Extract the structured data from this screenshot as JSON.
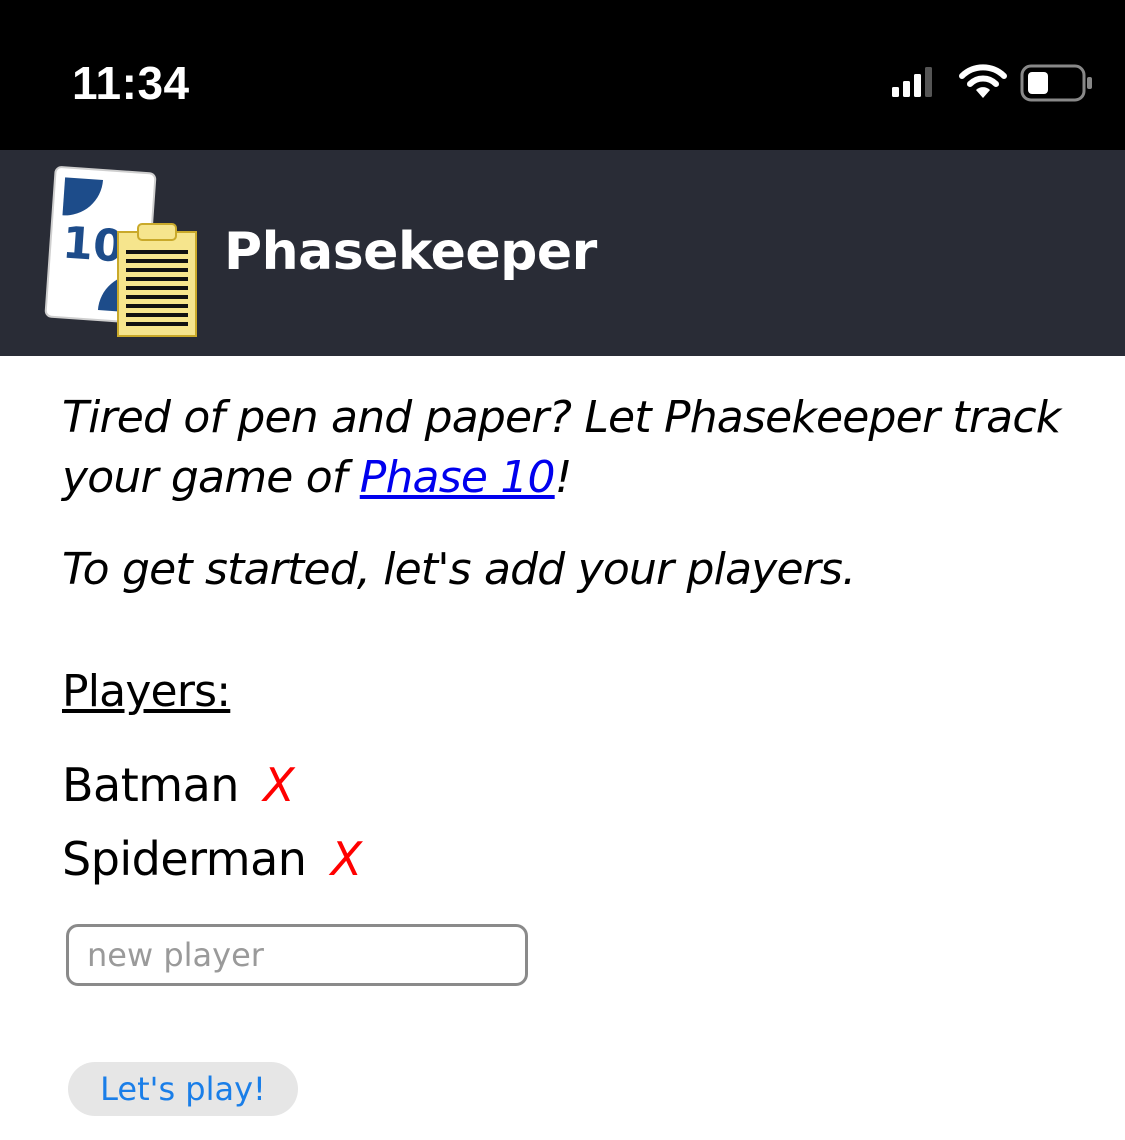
{
  "status_bar": {
    "time": "11:34",
    "icons": [
      "signal-icon",
      "wifi-icon",
      "battery-icon"
    ]
  },
  "header": {
    "title": "Phasekeeper",
    "logo_card_text": "10",
    "background": "#292c36"
  },
  "intro": {
    "line1_before": "Tired of pen and paper? Let Phasekeeper track your game of ",
    "link_text": "Phase 10",
    "line1_after": "!",
    "line2": "To get started, let's add your players."
  },
  "players": {
    "heading": "Players:",
    "remove_label": "X",
    "list": [
      {
        "name": "Batman"
      },
      {
        "name": "Spiderman"
      }
    ]
  },
  "new_player": {
    "placeholder": "new player",
    "value": ""
  },
  "play_button": {
    "label": "Let's play!"
  },
  "colors": {
    "remove": "#ff0000",
    "link": "#0000ee",
    "button_text": "#1a7ee8"
  }
}
